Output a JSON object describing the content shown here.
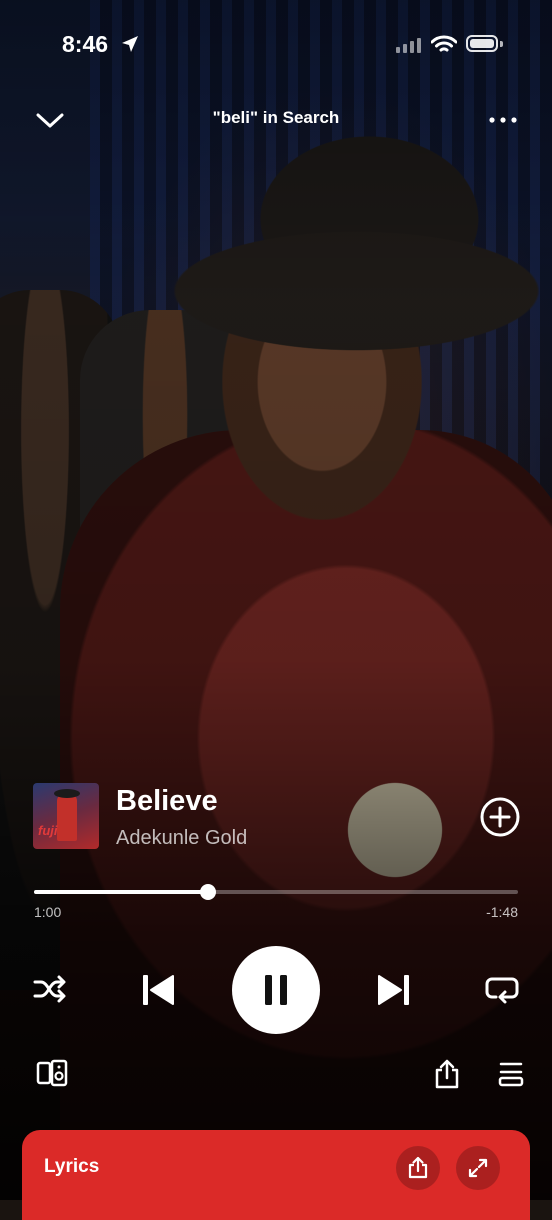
{
  "status_bar": {
    "time": "8:46"
  },
  "header": {
    "context_title": "\"beli\" in Search",
    "collapse_icon": "chevron-down-icon",
    "more_icon": "more-horizontal-icon"
  },
  "track": {
    "title": "Believe",
    "artist": "Adekunle Gold",
    "cover_text": "fuji",
    "add_icon": "add-circle-icon"
  },
  "playback": {
    "elapsed": "1:00",
    "remaining": "-1:48",
    "progress_fraction": 0.36,
    "state": "playing"
  },
  "controls": {
    "shuffle_icon": "shuffle-icon",
    "previous_icon": "skip-previous-icon",
    "pause_icon": "pause-icon",
    "next_icon": "skip-next-icon",
    "repeat_icon": "repeat-icon"
  },
  "utility": {
    "devices_icon": "connect-device-icon",
    "share_icon": "share-icon",
    "queue_icon": "queue-icon"
  },
  "lyrics_card": {
    "label": "Lyrics",
    "background": "#db2a28",
    "share_icon": "share-icon",
    "expand_icon": "expand-icon"
  }
}
